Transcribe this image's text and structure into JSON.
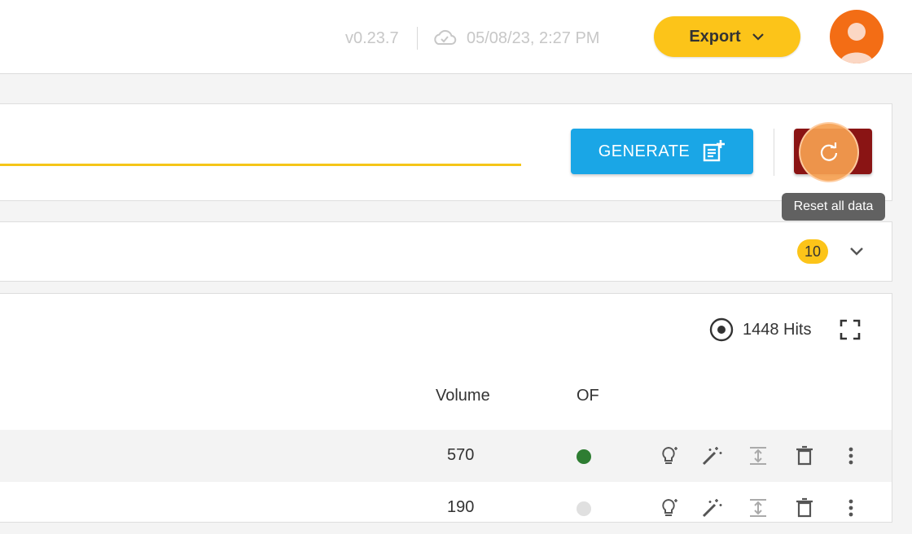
{
  "header": {
    "version": "v0.23.7",
    "saved_time": "05/08/23, 2:27 PM",
    "export_label": "Export"
  },
  "generate_panel": {
    "generate_label": "GENERATE",
    "reset_tooltip": "Reset all data"
  },
  "collapse_panel": {
    "count": "10"
  },
  "table": {
    "hits_label": "1448 Hits",
    "columns": {
      "volume": "Volume",
      "of": "OF"
    },
    "rows": [
      {
        "volume": "570",
        "of_status": "active"
      },
      {
        "volume": "190",
        "of_status": "inactive"
      }
    ]
  },
  "colors": {
    "accent_yellow": "#fcc419",
    "generate_blue": "#1aa6e6",
    "reset_red": "#8a1414",
    "avatar_orange": "#f36d15",
    "status_green": "#2e7d32",
    "status_grey": "#e0e0e0"
  },
  "icons": {
    "cloud": "cloud-icon",
    "export_chevron": "chevron-down-icon",
    "generate": "post-add-icon",
    "reset": "refresh-icon",
    "collapse_chevron": "chevron-down-icon",
    "hits": "target-icon",
    "fullscreen": "fullscreen-icon",
    "row_actions": [
      "lightbulb-icon",
      "magic-wand-icon",
      "expand-vertical-icon",
      "delete-icon",
      "more-vertical-icon"
    ]
  }
}
